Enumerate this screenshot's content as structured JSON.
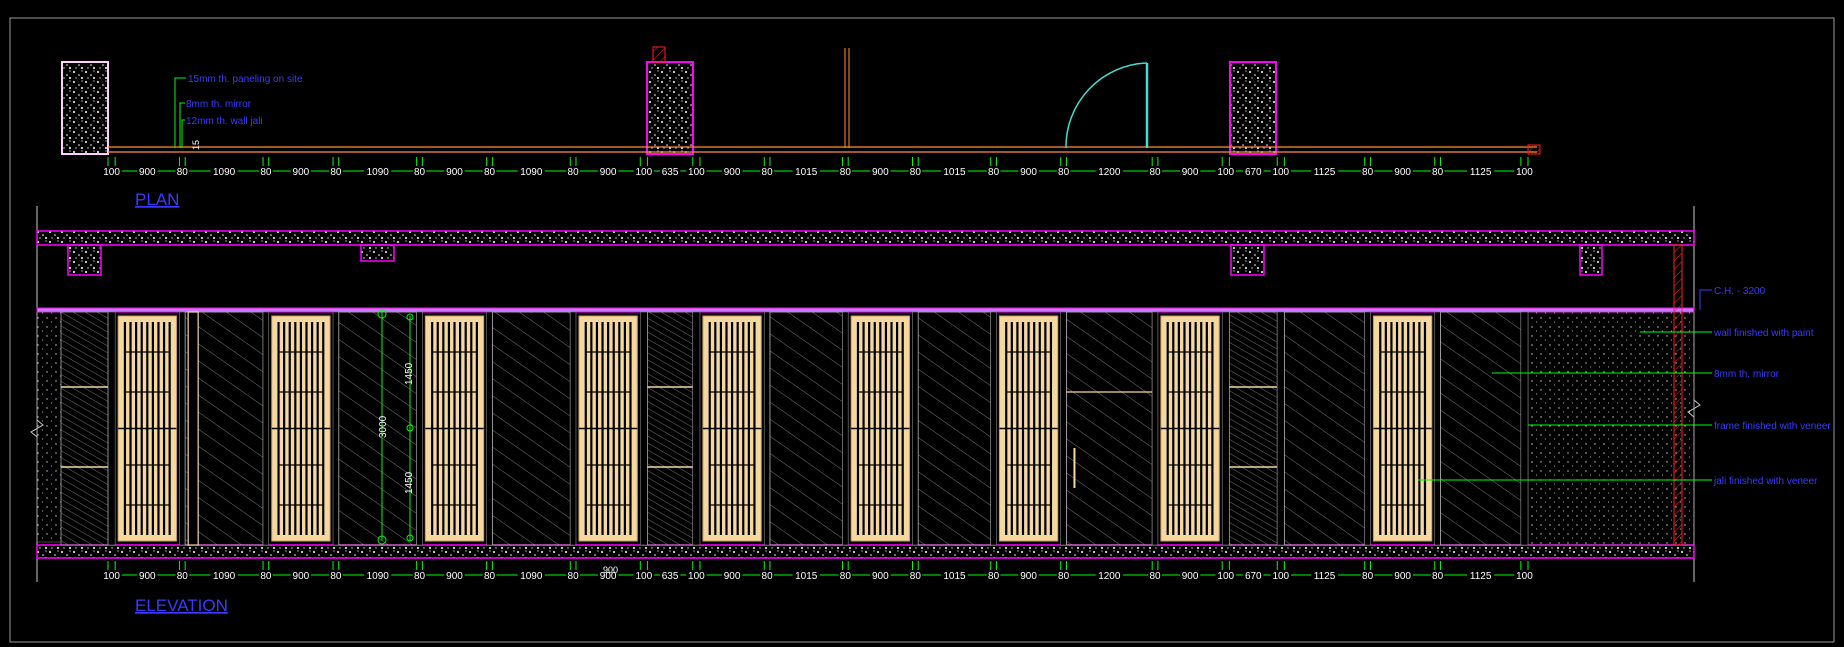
{
  "titles": {
    "plan": "PLAN",
    "elevation": "ELEVATION"
  },
  "plan_notes": [
    "15mm th. paneling on site",
    "8mm th. mirror",
    "12mm th. wall jali"
  ],
  "plan_dims": [
    "100",
    "900",
    "80",
    "1090",
    "80",
    "900",
    "80",
    "1090",
    "80",
    "900",
    "80",
    "1090",
    "80",
    "900",
    "100",
    "635",
    "100",
    "900",
    "80",
    "1015",
    "80",
    "900",
    "80",
    "1015",
    "80",
    "900",
    "80",
    "1200",
    "80",
    "900",
    "100",
    "670",
    "100",
    "1125",
    "80",
    "900",
    "80",
    "1125",
    "100"
  ],
  "elev_dims": [
    "100",
    "900",
    "80",
    "1090",
    "80",
    "900",
    "80",
    "1090",
    "80",
    "900",
    "80",
    "1090",
    "80",
    "900",
    "100",
    "635",
    "100",
    "900",
    "80",
    "1015",
    "80",
    "900",
    "80",
    "1015",
    "80",
    "900",
    "80",
    "1200",
    "80",
    "900",
    "100",
    "670",
    "100",
    "1125",
    "80",
    "900",
    "80",
    "1125",
    "100"
  ],
  "vertical_dims": {
    "total": "3000",
    "upper": "1450",
    "lower": "1450"
  },
  "small_marks": {
    "plan_15": "15",
    "elev_900": "900"
  },
  "annotations": {
    "ch": "C.H. - 3200",
    "wall": "wall finished with paint",
    "mirror": "8mm th. mirror",
    "frame": "frame finished with veneer",
    "jali": "jali finished with veneer"
  },
  "colors": {
    "background": "#000000",
    "text_blue": "#3a3aff",
    "dim_green": "#00ff00",
    "magenta": "#ff00ff",
    "panel_fill": "#f5d8a0",
    "orange": "#ff8c3c",
    "red": "#ff2020",
    "cyan": "#40e0d0",
    "white": "#ffffff",
    "gray": "#9a9a9a"
  }
}
